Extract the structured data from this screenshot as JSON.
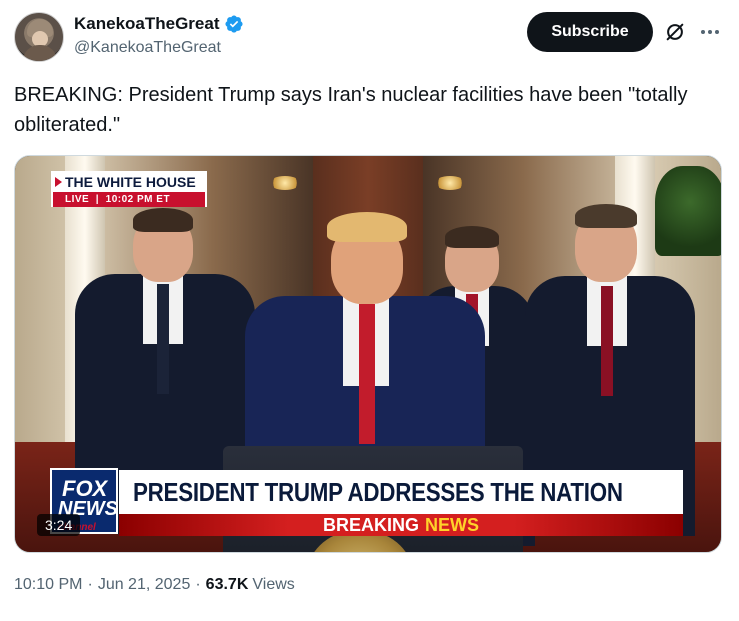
{
  "author": {
    "display_name": "KanekoaTheGreat",
    "handle": "@KanekoaTheGreat",
    "verified_color": "#1d9bf0"
  },
  "actions": {
    "subscribe_label": "Subscribe",
    "grok_icon": "grok-icon",
    "more_icon": "more-icon"
  },
  "tweet": {
    "text": "BREAKING: President Trump says Iran's nuclear facilities have been \"totally obliterated.\""
  },
  "video": {
    "location_title": "THE WHITE HOUSE",
    "live_label": "LIVE",
    "live_time": "10:02 PM ET",
    "network_logo_top": "FOX",
    "network_logo_mid": "NEWS",
    "network_logo_bottom": "channel",
    "chyron": "PRESIDENT TRUMP ADDRESSES THE NATION",
    "breaking_label": "BREAKING",
    "news_label": "NEWS",
    "duration": "3:24"
  },
  "meta": {
    "time": "10:10 PM",
    "date": "Jun 21, 2025",
    "views_count": "63.7K",
    "views_label": "Views",
    "separator": "·"
  },
  "colors": {
    "text_primary": "#0f1419",
    "text_secondary": "#536471",
    "subscribe_bg": "#0f1419",
    "fox_red": "#c8102e",
    "fox_blue": "#0a2a6e",
    "news_yellow": "#ffd22a"
  }
}
